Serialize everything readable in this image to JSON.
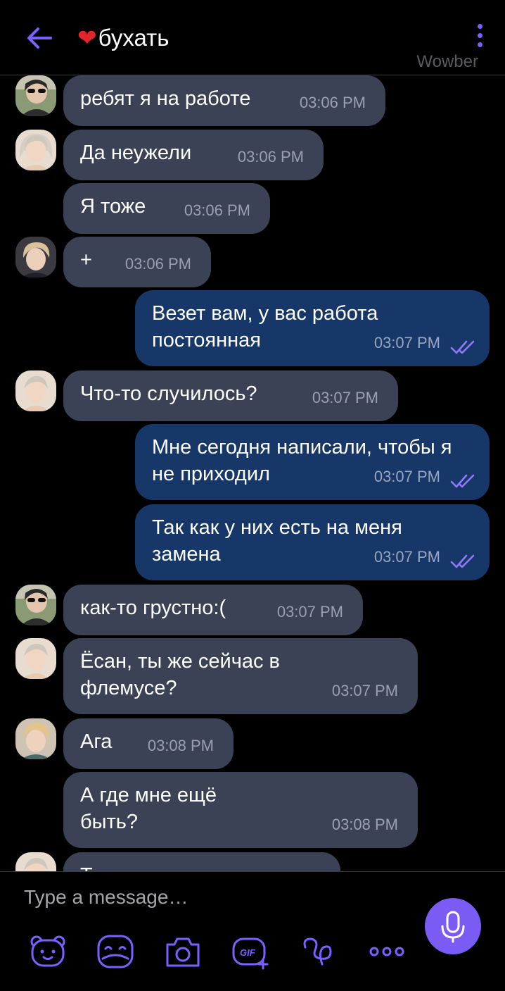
{
  "header": {
    "chat_title_heart": "❤",
    "chat_title": "бухать",
    "watermark": "Wowber"
  },
  "messages": [
    {
      "text": "ребят я на работе",
      "time": "03:06 PM"
    },
    {
      "text": "Да неужели",
      "time": "03:06 PM"
    },
    {
      "text": "Я тоже",
      "time": "03:06 PM"
    },
    {
      "text": "+",
      "time": "03:06 PM"
    },
    {
      "text": "Везет вам, у вас работа постоянная",
      "time": "03:07 PM"
    },
    {
      "text": "Что-то случилось?",
      "time": "03:07 PM"
    },
    {
      "text": "Мне сегодня написали, чтобы я не приходил",
      "time": "03:07 PM"
    },
    {
      "text": "Так как у них есть на меня замена",
      "time": "03:07 PM"
    },
    {
      "text": "как-то грустно:(",
      "time": "03:07 PM"
    },
    {
      "text": "Ёсан, ты же сейчас в флемусе?",
      "time": "03:07 PM"
    },
    {
      "text": "Ага",
      "time": "03:08 PM"
    },
    {
      "text": "А где мне ещё быть?",
      "time": "03:08 PM"
    },
    {
      "text": "Т",
      "time": ""
    }
  ],
  "composer": {
    "placeholder": "Type a message…"
  },
  "colors": {
    "accent": "#7a5cf4",
    "incoming_bubble": "#3c4255",
    "outgoing_bubble": "#173768",
    "background": "#000000"
  }
}
